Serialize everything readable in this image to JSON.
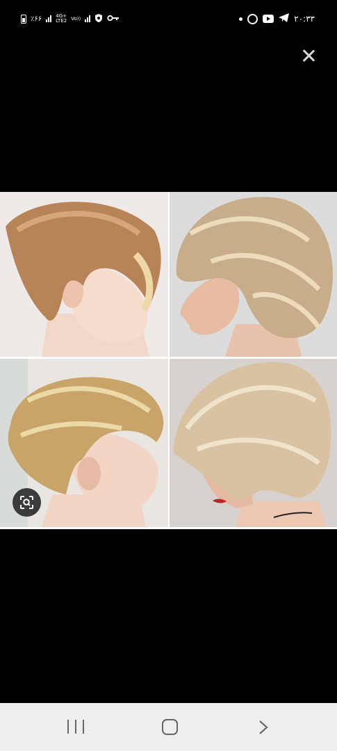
{
  "status_bar": {
    "battery_text": "٪۶۶",
    "network_top": "4G+",
    "network_bottom": "LTE2",
    "volte": "Vo))",
    "time": "۲۰:۳۳"
  },
  "viewer": {
    "tiles": [
      "hairstyle-photo-1",
      "hairstyle-photo-2",
      "hairstyle-photo-3",
      "hairstyle-photo-4"
    ]
  },
  "nav": {
    "icons": [
      "recents-icon",
      "home-icon",
      "back-icon"
    ]
  },
  "colors": {
    "background": "#000000",
    "nav_bar": "#eeeeee",
    "nav_icon": "#666666"
  }
}
